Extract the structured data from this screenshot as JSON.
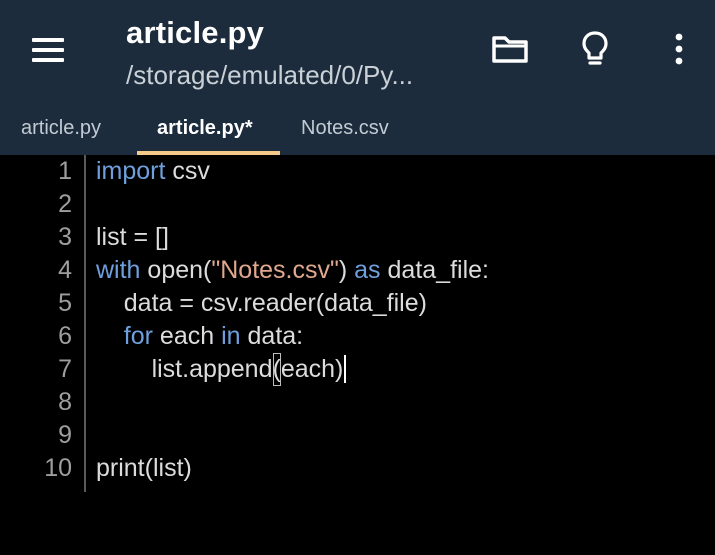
{
  "appbar": {
    "title": "article.py",
    "subtitle": "/storage/emulated/0/Py..."
  },
  "icons": {
    "menu": "hamburger-menu-icon",
    "folder": "folder-icon",
    "hint": "lightbulb-icon",
    "more": "more-vertical-icon"
  },
  "tabs": [
    {
      "label": "article.py",
      "active": false
    },
    {
      "label": "article.py*",
      "active": true
    },
    {
      "label": "Notes.csv",
      "active": false
    }
  ],
  "editor": {
    "line_numbers": [
      "1",
      "2",
      "3",
      "4",
      "5",
      "6",
      "7",
      "8",
      "9",
      "10"
    ],
    "lines": {
      "l1": {
        "kw": "import",
        "rest": " csv"
      },
      "l3": {
        "text": "list = []"
      },
      "l4": {
        "kw1": "with",
        "a": " open(",
        "str": "\"Notes.csv\"",
        "b": ") ",
        "kw2": "as",
        "c": " data_file:"
      },
      "l5": {
        "text": "    data = csv.reader(data_file)"
      },
      "l6": {
        "indent": "    ",
        "kw1": "for",
        "a": " each ",
        "kw2": "in",
        "b": " data:"
      },
      "l7": {
        "a": "        list.append",
        "paren": "(",
        "b": "each)"
      },
      "l10": {
        "text": "print(list)"
      }
    }
  },
  "colors": {
    "bar_background": "#1c2c3c",
    "editor_background": "#000000",
    "keyword": "#6f9fdc",
    "string": "#e0a88f",
    "tab_indicator": "#f4c98a"
  }
}
